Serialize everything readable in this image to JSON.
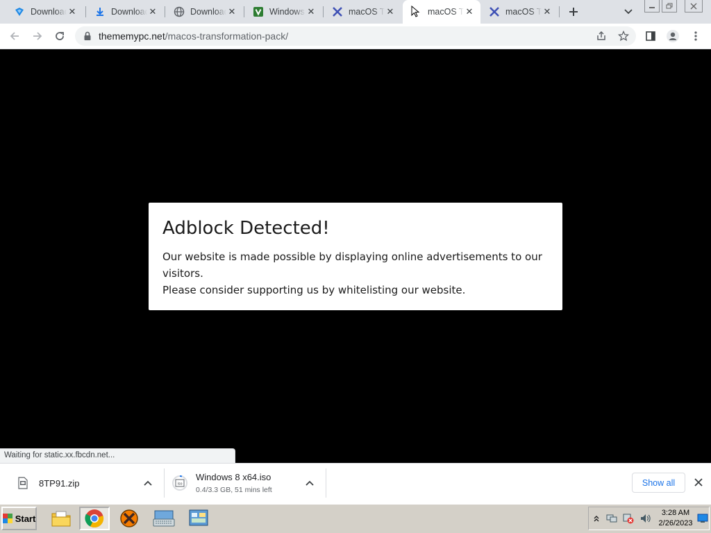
{
  "browser": {
    "tabs": [
      {
        "title": "Download",
        "icon": "blue-diamond-icon",
        "active": false
      },
      {
        "title": "Download",
        "icon": "download-arrow-icon",
        "active": false
      },
      {
        "title": "Download",
        "icon": "globe-icon",
        "active": false
      },
      {
        "title": "Windows",
        "icon": "green-v-icon",
        "active": false
      },
      {
        "title": "macOS Tr",
        "icon": "x-logo-icon",
        "active": false
      },
      {
        "title": "macOS T",
        "icon": "none",
        "active": true
      },
      {
        "title": "macOS Tr",
        "icon": "x-logo-icon",
        "active": false
      }
    ],
    "url_domain": "thememypc.net",
    "url_path": "/macos-transformation-pack/",
    "accent": "#1a73e8"
  },
  "modal": {
    "title": "Adblock Detected!",
    "line1": "Our website is made possible by displaying online advertisements to our visitors.",
    "line2": "Please consider supporting us by whitelisting our website."
  },
  "status_text": "Waiting for static.xx.fbcdn.net...",
  "downloads": {
    "items": [
      {
        "name": "8TP91.zip",
        "status": ""
      },
      {
        "name": "Windows 8 x64.iso",
        "status": "0.4/3.3 GB, 51 mins left"
      }
    ],
    "show_all_label": "Show all"
  },
  "taskbar": {
    "start_label": "Start",
    "time": "3:28 AM",
    "date": "2/26/2023"
  }
}
